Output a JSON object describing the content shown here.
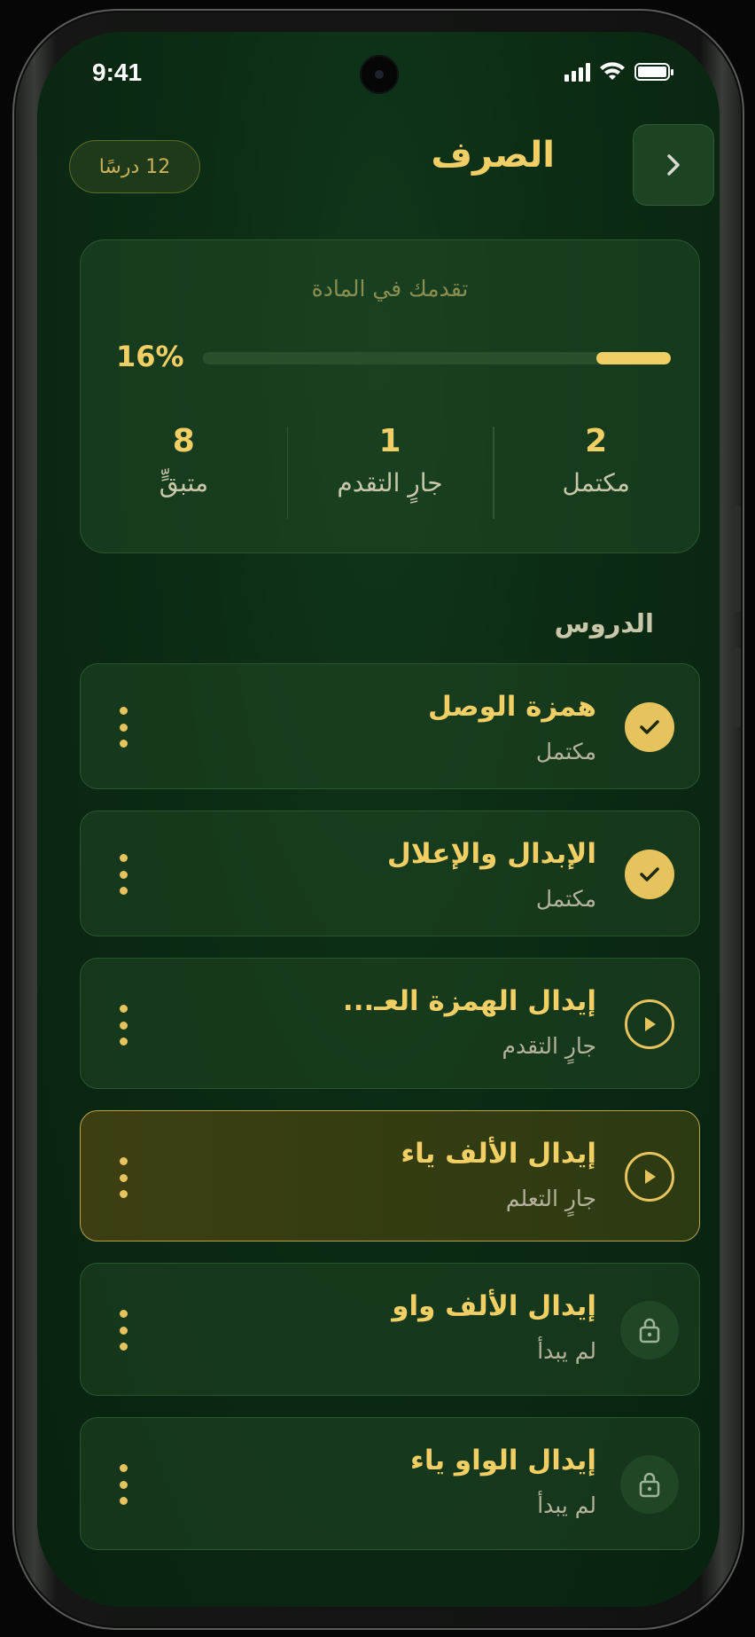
{
  "status_bar": {
    "time": "9:41"
  },
  "header": {
    "title": "الصرف",
    "lesson_count": "12 درسًا"
  },
  "progress": {
    "label": "تقدمك في المادة",
    "percent_text": "16%",
    "percent_value": 16,
    "stats": [
      {
        "value": "8",
        "label": "متبقٍّ"
      },
      {
        "value": "1",
        "label": "جارٍ التقدم"
      },
      {
        "value": "2",
        "label": "مكتمل"
      }
    ]
  },
  "lessons_section": {
    "title": "الدروس"
  },
  "lessons": [
    {
      "title": "همزة الوصل",
      "status": "مكتمل",
      "icon": "check-icon"
    },
    {
      "title": "الإبدال والإعلال",
      "status": "مكتمل",
      "icon": "check-icon"
    },
    {
      "title": "إيدال الهمزة العـ...",
      "status": "جارٍ التقدم",
      "icon": "play-icon"
    },
    {
      "title": "إيدال الألف ياء",
      "status": "جارٍ التعلم",
      "icon": "play-icon"
    },
    {
      "title": "إيدال الألف واو",
      "status": "لم يبدأ",
      "icon": "lock-icon"
    },
    {
      "title": "إيدال الواو ياء",
      "status": "لم يبدأ",
      "icon": "lock-icon"
    }
  ],
  "colors": {
    "accent": "#f2cf65",
    "background": "#0b2b13",
    "card": "#1d4424"
  }
}
